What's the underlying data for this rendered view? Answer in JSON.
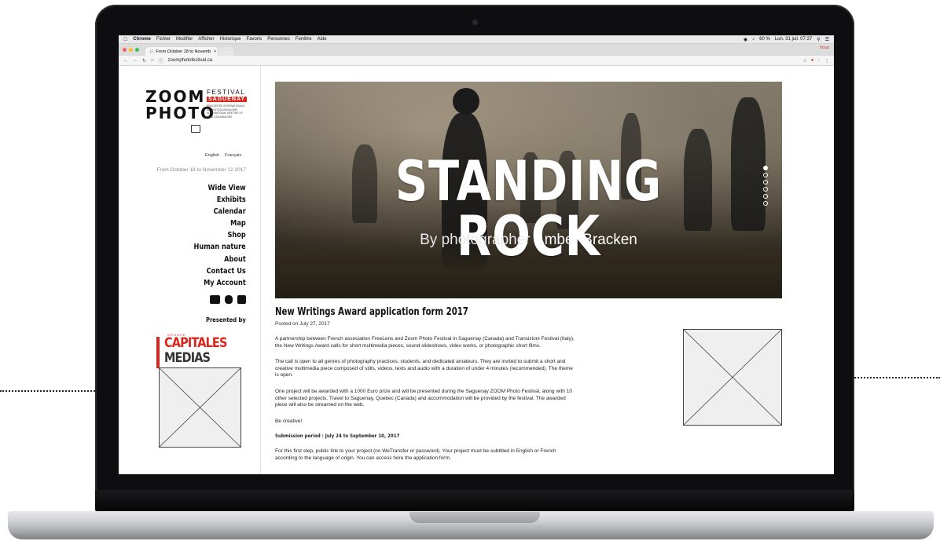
{
  "menubar": {
    "app": "Chrome",
    "items": [
      "Fichier",
      "Modifier",
      "Afficher",
      "Historique",
      "Favoris",
      "Personnes",
      "Fenêtre",
      "Aide"
    ],
    "battery": "60 %",
    "clock": "Lun. 31 juil. 07:37",
    "user": "Vous"
  },
  "browser": {
    "tab_title": "From October 18 to Novemb",
    "url": "zoomphotofestival.ca"
  },
  "sidebar": {
    "logo_zoom": "ZOOM",
    "logo_photo": "PHOTO",
    "logo_festival": "FESTIVAL",
    "logo_saguenay": "SAGUENAY",
    "logo_tagline": "RENCONTRE INTERNATIONALE DE PHOTOJOURNALISME INTERNATIONAL MEETING OF PHOTOJOURNALISM",
    "lang_en": "English",
    "lang_fr": "Français",
    "dates": "From October 18 to November 12 2017",
    "nav": [
      "Wide View",
      "Exhibits",
      "Calendar",
      "Map",
      "Shop",
      "Human nature",
      "About",
      "Contact Us",
      "My Account"
    ],
    "presented_by": "Presented by",
    "sponsor_groupe": "GROUPE",
    "sponsor_line1": "CAPITALES",
    "sponsor_line2": "MEDIAS"
  },
  "hero": {
    "title": "STANDING ROCK",
    "sub_prefix": "By photographer",
    "sub_name": "Amber Bracken"
  },
  "article": {
    "title": "New Writings Award application form 2017",
    "date": "Posted on July 27, 2017",
    "p1": "A partnership between French association FreeLens and Zoom Photo Festival in Saguenay (Canada) and Transizioni Festival (Italy), the New Writings Award calls for short multimedia pieces, sound slideshows, video works, or photographic short films.",
    "p2": "The call is open to all genres of photography practices, students, and dedicated amateurs. They are invited to submit a short and creative multimedia piece composed of stills, videos, texts and audio with a duration of under 4 minutes (recommended). The theme is open.",
    "p3": "One project will be awarded with a 1000 Euro prize and will be presented during the Saguenay ZOOM Photo Festival, along with 10 other selected projects. Travel to Saguenay, Quebec (Canada) and accommodation will be provided by the festival. The awarded piece will also be streamed on the web.",
    "p4": "Be creative!",
    "submission": "Submission period : July 24 to September 10, 2017",
    "p5": "For this first step, public link to your project (no WeTransfer or password). Your project must be subtitled in English or French according to the language of origin. You can access here the application form."
  }
}
